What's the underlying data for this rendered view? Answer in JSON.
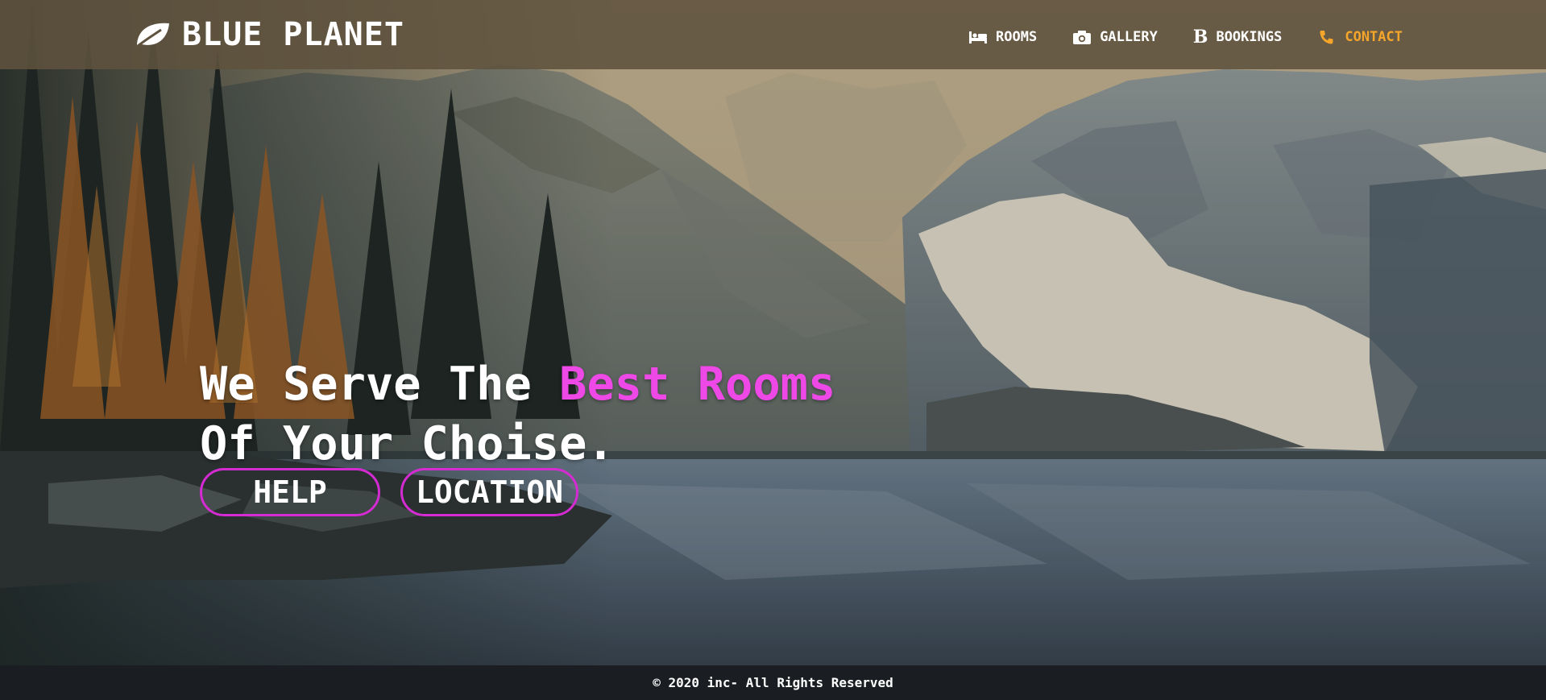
{
  "brand": {
    "name": "BLUE PLANET",
    "icon": "leaf-icon"
  },
  "nav": {
    "items": [
      {
        "label": "ROOMS",
        "icon": "bed-icon",
        "active": false
      },
      {
        "label": "GALLERY",
        "icon": "camera-icon",
        "active": false
      },
      {
        "label": "BOOKINGS",
        "icon": "bold-b-icon",
        "glyph": "B",
        "active": false
      },
      {
        "label": "CONTACT",
        "icon": "phone-icon",
        "active": true
      }
    ]
  },
  "hero": {
    "line1_prefix": "We Serve The ",
    "line1_accent": "Best Rooms",
    "line2": "Of Your Choise.",
    "buttons": {
      "help": "HELP",
      "location": "LOCATION"
    }
  },
  "footer": {
    "text": "© 2020 inc- All Rights Reserved"
  },
  "colors": {
    "accent_pink": "#ee48e6",
    "button_border": "#d42bd3",
    "nav_active": "#f4a52a",
    "header_bg": "#5f523e",
    "footer_bg": "#1a1e22"
  }
}
